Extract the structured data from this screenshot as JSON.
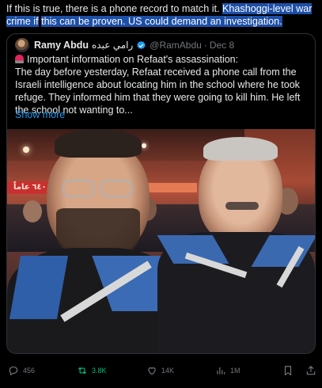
{
  "tweet": {
    "text_before": "If this is true, there is a phone record to match it. ",
    "text_highlighted_1": "Khashoggi-level war crime if",
    "text_highlighted_2": "this can be proven. US could demand an investigation."
  },
  "quote": {
    "name": "Ramy Abdu",
    "name_arabic": "رامي عبده",
    "handle": "@RamAbdu",
    "separator": "·",
    "date": "Dec 8",
    "line1": "Important information on Refaat's assassination:",
    "body": "The day before yesterday, Refaat received a phone call from the Israeli intelligence about locating him in the school where he took refuge. They informed him that they were going to kill him. He left the school not wanting to...",
    "show_more": "Show more",
    "photo_banner": "٦٤٠ عاماً",
    "siren_icon": "police-car-light-icon"
  },
  "actions": {
    "replies": "456",
    "reposts": "3.8K",
    "likes": "14K",
    "views": "1M"
  },
  "colors": {
    "background": "#000000",
    "text": "#e7e9ea",
    "muted": "#71767b",
    "link": "#1d9bf0",
    "repost_active": "#00ba7c",
    "highlight": "#1d4fa8",
    "border": "#2f3336"
  }
}
